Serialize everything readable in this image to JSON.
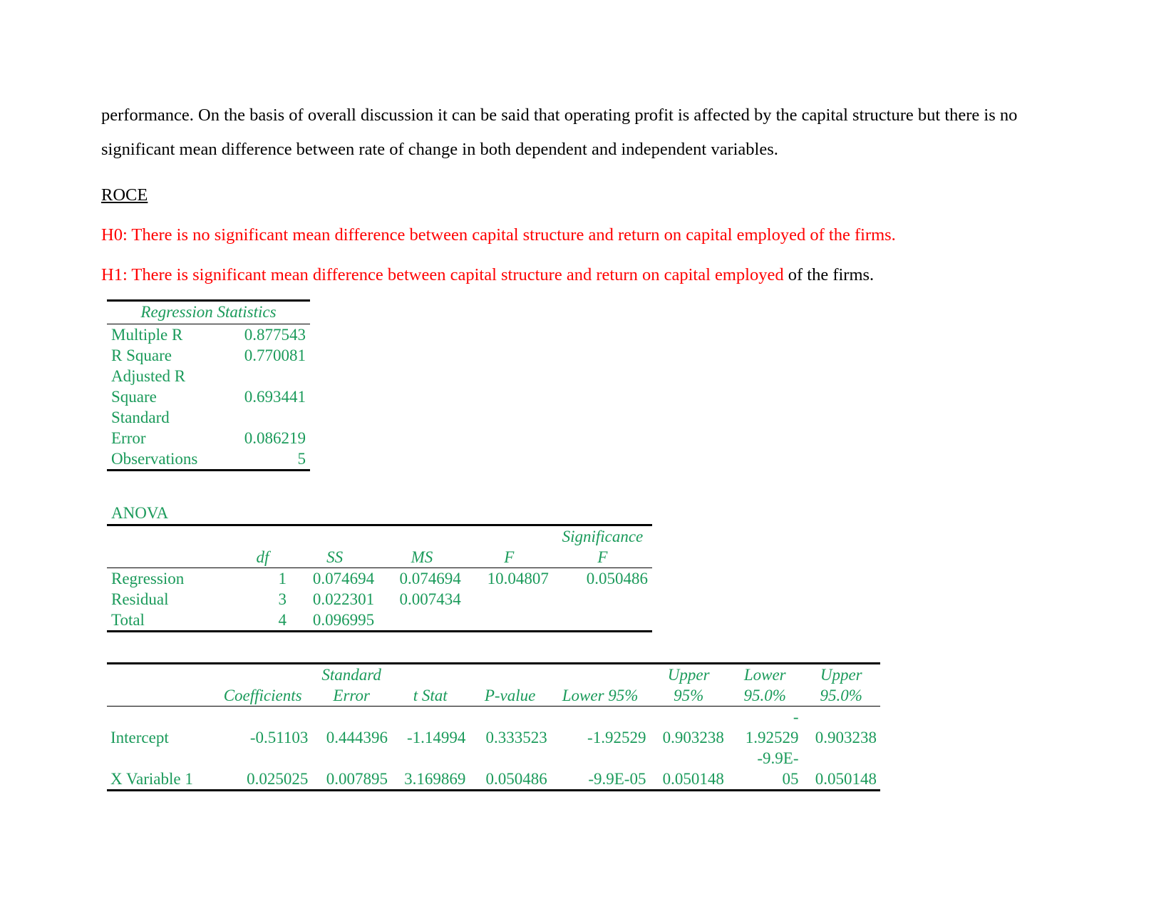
{
  "document": {
    "paragraph_1": "performance. On the basis of overall discussion it can be said that operating profit is affected by the capital structure but there is no significant mean difference between rate of change in both dependent and independent variables.",
    "paragraph_1_line1": "performance. On the basis of overall discussion it can be said that operating profit is affected by the capital structure but there is no",
    "paragraph_1_line2": "significant mean difference between rate of change in both dependent and independent variables.",
    "section_heading": "ROCE",
    "hypothesis_null": "H0: There is no significant mean difference between capital structure and return on capital employed of the firms.",
    "hypothesis_alt_red": "H1: There is significant mean difference between capital structure and return on capital employed",
    "hypothesis_alt_black": " of the firms.",
    "colors": {
      "body_text": "#000000",
      "hypothesis_red": "#ff0000",
      "table_green": "#1a9a5a",
      "rule_black": "#000000"
    }
  },
  "regression_statistics": {
    "title": "Regression Statistics",
    "rows": [
      {
        "label": "Multiple R",
        "value": "0.877543"
      },
      {
        "label": "R Square",
        "value": "0.770081"
      },
      {
        "label": "Adjusted R Square",
        "label_line1": "Adjusted R",
        "label_line2": "Square",
        "value": "0.693441"
      },
      {
        "label": "Standard Error",
        "label_line1": "Standard",
        "label_line2": "Error",
        "value": "0.086219"
      },
      {
        "label": "Observations",
        "value": "5"
      }
    ]
  },
  "anova": {
    "caption": "ANOVA",
    "headers": [
      "",
      "df",
      "SS",
      "MS",
      "F",
      "Significance F"
    ],
    "header_sig_line1": "Significance",
    "header_sig_line2": "F",
    "rows": [
      {
        "source": "Regression",
        "df": "1",
        "ss": "0.074694",
        "ms": "0.074694",
        "f": "10.04807",
        "significance_f": "0.050486"
      },
      {
        "source": "Residual",
        "df": "3",
        "ss": "0.022301",
        "ms": "0.007434",
        "f": "",
        "significance_f": ""
      },
      {
        "source": "Total",
        "df": "4",
        "ss": "0.096995",
        "ms": "",
        "f": "",
        "significance_f": ""
      }
    ]
  },
  "coefficients": {
    "headers": {
      "label": "",
      "coefficients": "Coefficients",
      "standard_error_line1": "Standard",
      "standard_error_line2": "Error",
      "t_stat": "t Stat",
      "p_value": "P-value",
      "lower_95": "Lower 95%",
      "upper_95_line1": "Upper",
      "upper_95_line2": "95%",
      "lower_95_0_line1": "Lower",
      "lower_95_0_line2": "95.0%",
      "upper_95_0_line1": "Upper",
      "upper_95_0_line2": "95.0%"
    },
    "rows": [
      {
        "term": "Intercept",
        "coefficient": "-0.51103",
        "standard_error": "0.444396",
        "t_stat": "-1.14994",
        "p_value": "0.333523",
        "lower_95": "-1.92529",
        "upper_95": "0.903238",
        "lower_95_0": "-1.92529",
        "lower_95_0_line1": "-",
        "lower_95_0_line2": "1.92529",
        "upper_95_0": "0.903238"
      },
      {
        "term": "X Variable 1",
        "coefficient": "0.025025",
        "standard_error": "0.007895",
        "t_stat": "3.169869",
        "p_value": "0.050486",
        "lower_95": "-9.9E-05",
        "upper_95": "0.050148",
        "lower_95_0": "-9.9E-05",
        "lower_95_0_line1": "-9.9E-",
        "lower_95_0_line2": "05",
        "upper_95_0": "0.050148"
      }
    ]
  }
}
